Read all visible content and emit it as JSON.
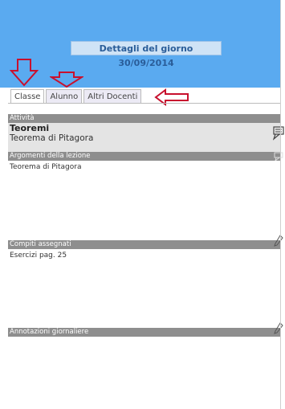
{
  "header": {
    "title": "Dettagli del giorno 30/09/2014"
  },
  "tabs": [
    {
      "label": "Classe"
    },
    {
      "label": "Alunno"
    },
    {
      "label": "Altri Docenti"
    }
  ],
  "sections": {
    "attivita": {
      "label": "Attività",
      "title": "Teoremi",
      "subtitle": "Teorema di Pitagora"
    },
    "argomenti": {
      "label": "Argomenti della lezione",
      "content": "Teorema di Pitagora"
    },
    "compiti": {
      "label": "Compiti assegnati",
      "content": "Esercizi pag. 25"
    },
    "annotazioni": {
      "label": "Annotazioni giornaliere",
      "content": ""
    }
  },
  "colors": {
    "header": "#5aaaf0",
    "section_bar": "#8e8e8e",
    "arrow": "#c8102e"
  },
  "icons": [
    "down-arrow-annotation",
    "left-arrow-annotation",
    "comment-icon",
    "edit-icon"
  ]
}
